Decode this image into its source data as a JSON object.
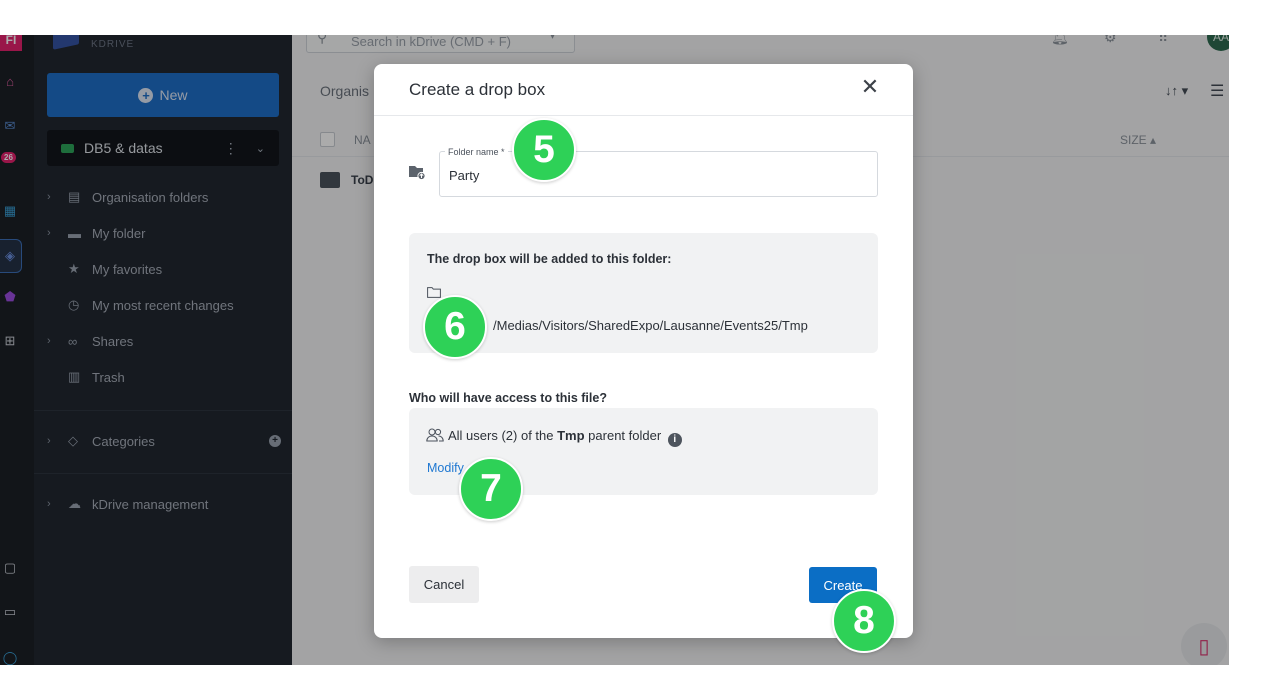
{
  "rail": {
    "logo_text": "FI",
    "notification_count": "26"
  },
  "sidebar": {
    "logo_label": "KDRIVE",
    "new_button": "New",
    "drive_name": "DB5 & datas",
    "items": [
      {
        "label": "Organisation folders",
        "icon": "building-folder-icon",
        "expandable": true
      },
      {
        "label": "My folder",
        "icon": "folder-icon",
        "expandable": true
      },
      {
        "label": "My favorites",
        "icon": "star-icon",
        "expandable": false
      },
      {
        "label": "My most recent changes",
        "icon": "clock-icon",
        "expandable": false
      },
      {
        "label": "Shares",
        "icon": "link-icon",
        "expandable": true
      },
      {
        "label": "Trash",
        "icon": "trash-icon",
        "expandable": false
      }
    ],
    "categories_label": "Categories",
    "management_label": "kDrive management"
  },
  "main": {
    "search_placeholder": "Search in kDrive (CMD + F)",
    "avatar_initials": "AA",
    "breadcrumb": "Organis",
    "col_name": "NA",
    "col_size": "SIZE",
    "row_name": "ToD"
  },
  "dialog": {
    "title": "Create a drop box",
    "folder_name_label": "Folder name *",
    "folder_name_value": "Party",
    "destination_title": "The drop box will be added to this folder:",
    "destination_path": "/Medias/Visitors/SharedExpo/Lausanne/Events25/Tmp",
    "access_question": "Who will have access to this file?",
    "access_prefix": "All users (2) of the ",
    "access_folder": "Tmp",
    "access_suffix": " parent folder",
    "modify_link": "Modify",
    "cancel_button": "Cancel",
    "create_button": "Create"
  },
  "steps": [
    "5",
    "6",
    "7",
    "8"
  ],
  "colors": {
    "primary": "#0b6ec5",
    "step_marker": "#2ed157",
    "sidebar_bg": "#222831",
    "link": "#1f78d1"
  }
}
